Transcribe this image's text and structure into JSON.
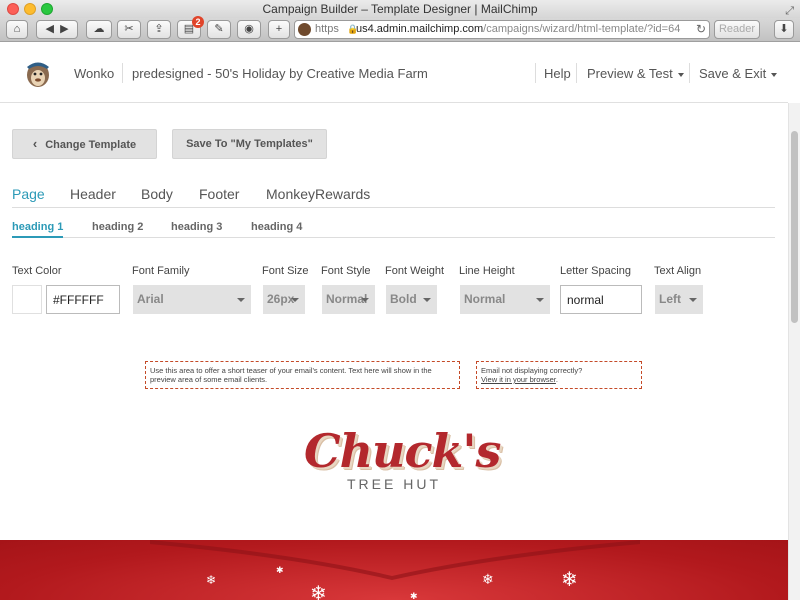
{
  "window": {
    "title": "Campaign Builder – Template Designer | MailChimp"
  },
  "browser": {
    "url_https": "https",
    "url_host": "us4.admin.mailchimp.com",
    "url_path": "/campaigns/wizard/html-template/?id=64",
    "reader_label": "Reader",
    "notification_count": "2"
  },
  "header": {
    "user": "Wonko",
    "campaign_name": "predesigned - 50's Holiday by Creative Media Farm",
    "help": "Help",
    "preview_test": "Preview & Test",
    "save_exit": "Save & Exit"
  },
  "actions": {
    "change_template": "Change Template",
    "save_to_templates": "Save To \"My Templates\""
  },
  "tabs": [
    {
      "label": "Page",
      "active": true
    },
    {
      "label": "Header",
      "active": false
    },
    {
      "label": "Body",
      "active": false
    },
    {
      "label": "Footer",
      "active": false
    },
    {
      "label": "MonkeyRewards",
      "active": false
    }
  ],
  "subtabs": [
    {
      "label": "heading 1",
      "active": true
    },
    {
      "label": "heading 2",
      "active": false
    },
    {
      "label": "heading 3",
      "active": false
    },
    {
      "label": "heading 4",
      "active": false
    }
  ],
  "style_fields": {
    "text_color": {
      "label": "Text Color",
      "value": "#FFFFFF",
      "swatch": "#FFFFFF"
    },
    "font_family": {
      "label": "Font Family",
      "value": "Arial"
    },
    "font_size": {
      "label": "Font Size",
      "value": "26px"
    },
    "font_style": {
      "label": "Font Style",
      "value": "Normal"
    },
    "font_weight": {
      "label": "Font Weight",
      "value": "Bold"
    },
    "line_height": {
      "label": "Line Height",
      "value": "Normal"
    },
    "letter_spacing": {
      "label": "Letter Spacing",
      "value": "normal"
    },
    "text_align": {
      "label": "Text Align",
      "value": "Left"
    }
  },
  "email_preview": {
    "preheader_teaser": "Use this area to offer a short teaser of your email's content. Text here will show in the preview area of some email clients.",
    "preheader_browser_line": "Email not displaying correctly?",
    "preheader_browser_link": "View it in your browser",
    "preheader_browser_period": ".",
    "logo_title": "Chuck's",
    "logo_subtitle": "TREE HUT"
  },
  "colors": {
    "accent": "#2c9ab7",
    "banner_red": "#b2191d",
    "preheader_border": "#c44a28"
  }
}
